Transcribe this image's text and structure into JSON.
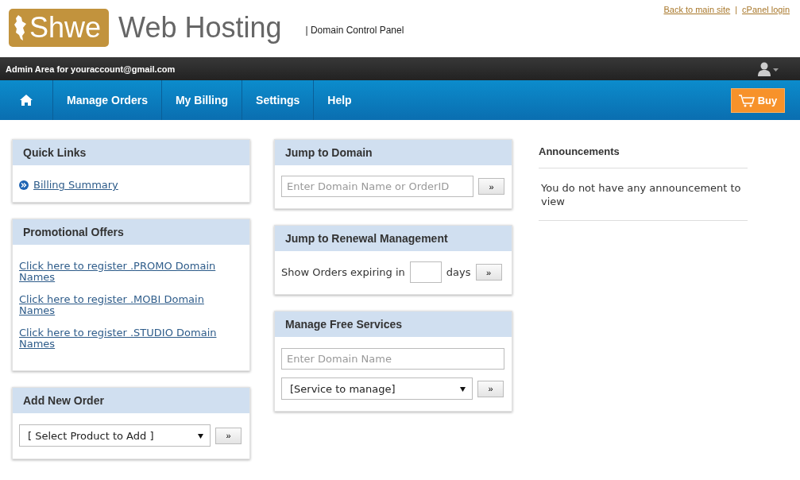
{
  "logo": {
    "badge": "Shwe",
    "text": "Web Hosting"
  },
  "tagline": "| Domain Control Panel",
  "top_links": {
    "items": [
      "Back to main site",
      "cPanel login"
    ],
    "separator": "|"
  },
  "admin_bar": {
    "text": "Admin Area for youraccount@gmail.com"
  },
  "nav": {
    "items": [
      {
        "label": "Manage Orders"
      },
      {
        "label": "My Billing"
      },
      {
        "label": "Settings"
      },
      {
        "label": "Help"
      }
    ],
    "buy_button": "Buy"
  },
  "columns": [
    [
      {
        "kind": "quick-links",
        "title": "Quick Links",
        "links": [
          "Billing Summary"
        ]
      },
      {
        "kind": "promo",
        "title": "Promotional Offers",
        "links": [
          "Click here to register .PROMO Domain Names",
          "Click here to register .MOBI Domain Names",
          "Click here to register .STUDIO Domain Names"
        ]
      },
      {
        "kind": "select",
        "title": "Add New Order",
        "select": "[ Select Product to Add ]",
        "go": "»"
      }
    ],
    [
      {
        "kind": "input",
        "title": "Jump to Domain",
        "placeholder": "Enter Domain Name or OrderID",
        "go": "»"
      },
      {
        "kind": "renewal",
        "title": "Jump to Renewal Management",
        "before": "Show Orders expiring in",
        "after": "days",
        "go": "»"
      },
      {
        "kind": "free-services",
        "title": "Manage Free Services",
        "placeholder": "Enter Domain Name",
        "select": "[Service to manage]",
        "go": "»"
      }
    ]
  ],
  "announcements": {
    "title": "Announcements",
    "message": "You do not have any announcement to view"
  }
}
